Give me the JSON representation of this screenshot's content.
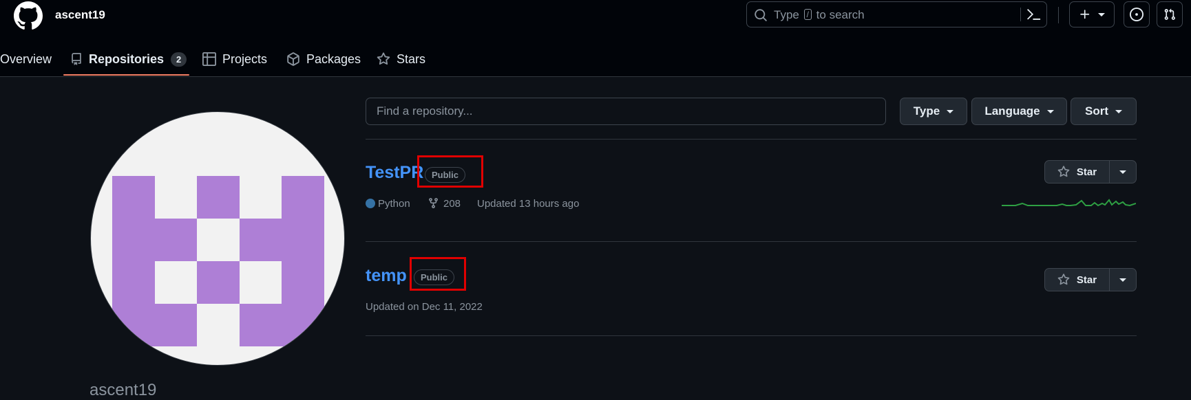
{
  "header": {
    "username": "ascent19",
    "search": {
      "prefix": "Type",
      "key": "/",
      "suffix": "to search"
    },
    "icons": [
      "github-logo-icon",
      "search-icon",
      "terminal-icon",
      "plus-icon",
      "issues-icon",
      "pull-requests-icon"
    ]
  },
  "nav": {
    "tabs": [
      {
        "label": "Overview",
        "icon": ""
      },
      {
        "label": "Repositories",
        "icon": "repo-icon",
        "count": "2",
        "active": true
      },
      {
        "label": "Projects",
        "icon": "table-icon"
      },
      {
        "label": "Packages",
        "icon": "package-icon"
      },
      {
        "label": "Stars",
        "icon": "star-icon"
      }
    ]
  },
  "profile": {
    "name": "ascent19"
  },
  "filters": {
    "find_placeholder": "Find a repository...",
    "type_label": "Type",
    "language_label": "Language",
    "sort_label": "Sort"
  },
  "repos": [
    {
      "name": "TestPR",
      "visibility": "Public",
      "language": "Python",
      "language_color": "#3572a5",
      "forks": "208",
      "updated": "Updated 13 hours ago",
      "star_label": "Star"
    },
    {
      "name": "temp",
      "visibility": "Public",
      "updated": "Updated on Dec 11, 2022",
      "star_label": "Star"
    }
  ],
  "colors": {
    "background": "#0d1117",
    "header_bg": "#010409",
    "link": "#4493f8",
    "active_tab_underline": "#f78166",
    "avatar_purple": "#ae7fd6",
    "highlight_box": "#e00000",
    "sparkline": "#2ea043"
  }
}
